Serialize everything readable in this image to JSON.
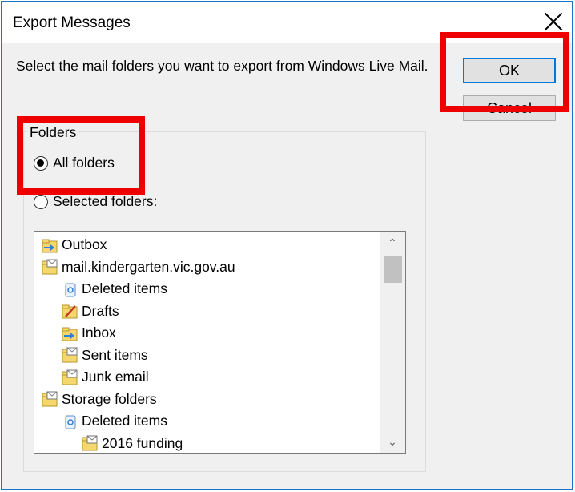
{
  "dialog": {
    "title": "Export Messages",
    "instruction": "Select the mail folders you want to export from Windows Live Mail.",
    "ok_label": "OK",
    "cancel_label": "Cancel"
  },
  "folders": {
    "group_label": "Folders",
    "all_folders_label": "All folders",
    "selected_folders_label": "Selected folders:",
    "selected_option": "All folders",
    "tree": [
      {
        "label": "Outbox",
        "icon": "outbox-folder-icon",
        "level": 0
      },
      {
        "label": "mail.kindergarten.vic.gov.au",
        "icon": "mail-account-icon",
        "level": 0
      },
      {
        "label": "Deleted items",
        "icon": "recycle-folder-icon",
        "level": 1
      },
      {
        "label": "Drafts",
        "icon": "drafts-folder-icon",
        "level": 1
      },
      {
        "label": "Inbox",
        "icon": "inbox-folder-icon",
        "level": 1
      },
      {
        "label": "Sent items",
        "icon": "sent-folder-icon",
        "level": 1
      },
      {
        "label": "Junk email",
        "icon": "junk-folder-icon",
        "level": 1
      },
      {
        "label": "Storage folders",
        "icon": "storage-folder-icon",
        "level": 0
      },
      {
        "label": "Deleted items",
        "icon": "recycle-folder-icon",
        "level": 1
      },
      {
        "label": "2016 funding",
        "icon": "mail-folder-icon",
        "level": 2
      }
    ]
  },
  "colors": {
    "highlight": "#ee0000",
    "focus_border": "#0078d7",
    "folder_yellow": "#f5d76e"
  }
}
